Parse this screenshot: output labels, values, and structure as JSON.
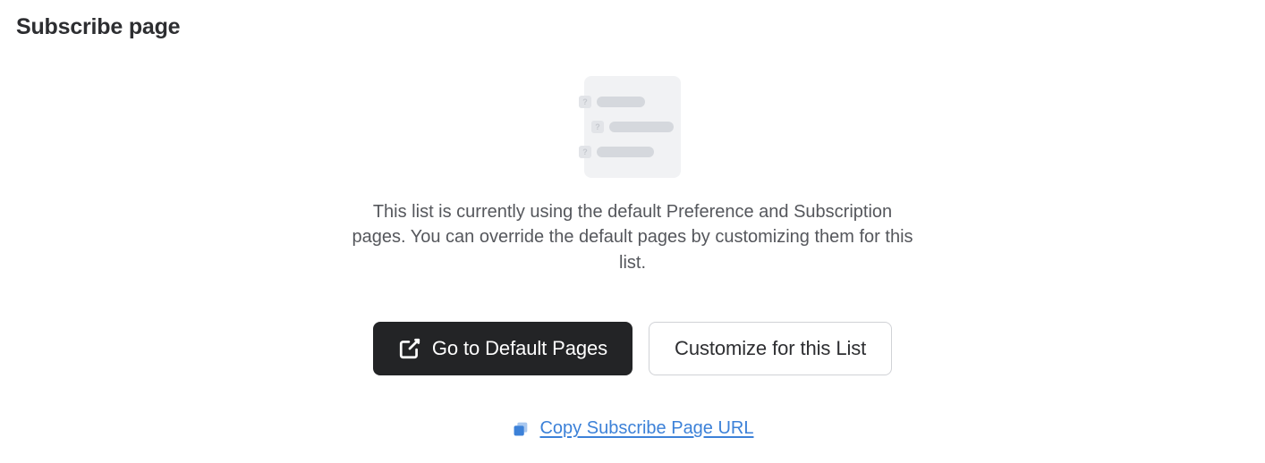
{
  "title": "Subscribe page",
  "description": "This list is currently using the default Preference and Subscription pages. You can override the default pages by customizing them for this list.",
  "buttons": {
    "go_default": "Go to Default Pages",
    "customize": "Customize for this List"
  },
  "copy_link": "Copy Subscribe Page URL"
}
